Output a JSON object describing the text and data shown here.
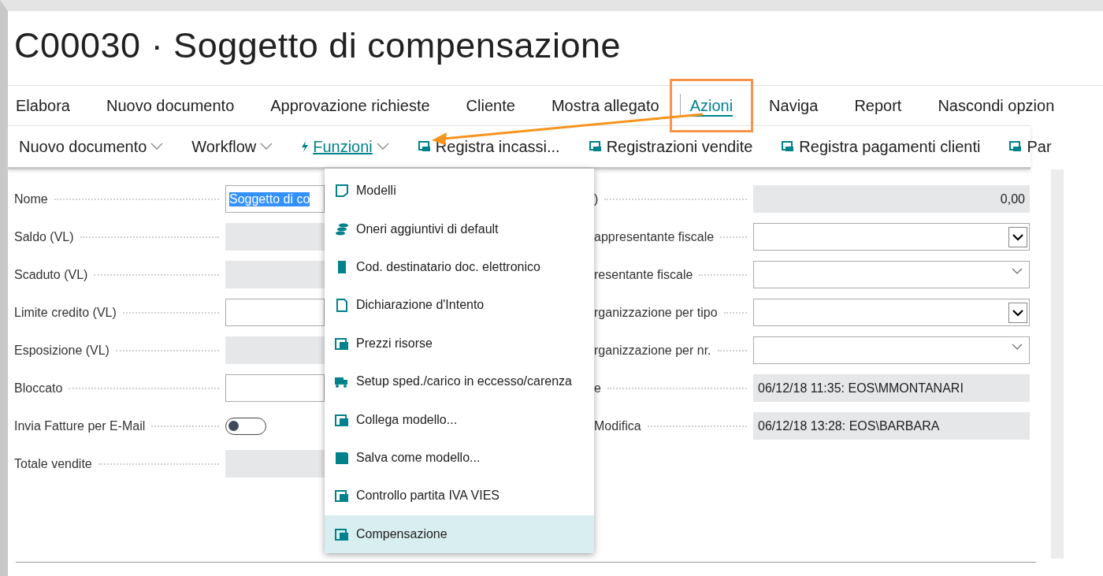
{
  "page": {
    "title": "C00030 · Soggetto di compensazione"
  },
  "action_tabs": [
    {
      "label": "Elabora",
      "selected": false
    },
    {
      "label": "Nuovo documento",
      "selected": false
    },
    {
      "label": "Approvazione richieste",
      "selected": false
    },
    {
      "label": "Cliente",
      "selected": false
    },
    {
      "label": "Mostra allegato",
      "selected": false
    },
    {
      "label": "Azioni",
      "selected": true
    },
    {
      "label": "Naviga",
      "selected": false
    },
    {
      "label": "Report",
      "selected": false
    },
    {
      "label": "Nascondi opzion",
      "selected": false
    }
  ],
  "toolbar": [
    {
      "label": "Nuovo documento",
      "kind": "dropdown",
      "selected": false
    },
    {
      "label": "Workflow",
      "kind": "dropdown",
      "selected": false
    },
    {
      "label": "Funzioni",
      "kind": "dropdown",
      "selected": true
    },
    {
      "label": "Registra incassi...",
      "kind": "action",
      "selected": false
    },
    {
      "label": "Registrazioni vendite",
      "kind": "action",
      "selected": false
    },
    {
      "label": "Registra pagamenti clienti",
      "kind": "action",
      "selected": false
    },
    {
      "label": "Par",
      "kind": "action",
      "selected": false
    }
  ],
  "left_fields": [
    {
      "label": "Nome",
      "kind": "text",
      "value": "Soggetto di co",
      "highlighted": true
    },
    {
      "label": "Saldo (VL)",
      "kind": "readonly"
    },
    {
      "label": "Scaduto (VL)",
      "kind": "readonly"
    },
    {
      "label": "Limite credito (VL)",
      "kind": "text"
    },
    {
      "label": "Esposizione (VL)",
      "kind": "readonly"
    },
    {
      "label": "Bloccato",
      "kind": "text"
    },
    {
      "label": "Invia Fatture per E-Mail",
      "kind": "toggle",
      "on": false
    },
    {
      "label": "Totale vendite",
      "kind": "readonly"
    }
  ],
  "right_fields": [
    {
      "label": ")",
      "kind": "readonly",
      "value": "0,00"
    },
    {
      "label": "appresentante fiscale",
      "kind": "select",
      "focused": true
    },
    {
      "label": "resentante fiscale",
      "kind": "select",
      "focused": false
    },
    {
      "label": "rganizzazione per tipo",
      "kind": "select",
      "focused": true
    },
    {
      "label": "rganizzazione per nr.",
      "kind": "select",
      "focused": false
    },
    {
      "label": "e",
      "kind": "readonly",
      "value": "06/12/18 11:35: EOS\\MMONTANARI"
    },
    {
      "label": "Modifica",
      "kind": "readonly",
      "value": "06/12/18 13:28: EOS\\BARBARA"
    }
  ],
  "menu": {
    "items": [
      {
        "label": "Modelli",
        "selected": false
      },
      {
        "label": "Oneri aggiuntivi di default",
        "selected": false
      },
      {
        "label": "Cod. destinatario doc. elettronico",
        "selected": false
      },
      {
        "label": "Dichiarazione d'Intento",
        "selected": false
      },
      {
        "label": "Prezzi risorse",
        "selected": false
      },
      {
        "label": "Setup sped./carico in eccesso/carenza",
        "selected": false
      },
      {
        "label": "Collega modello...",
        "selected": false
      },
      {
        "label": "Salva come modello...",
        "selected": false
      },
      {
        "label": "Controllo partita IVA VIES",
        "selected": false
      },
      {
        "label": "Compensazione",
        "selected": true
      }
    ]
  }
}
